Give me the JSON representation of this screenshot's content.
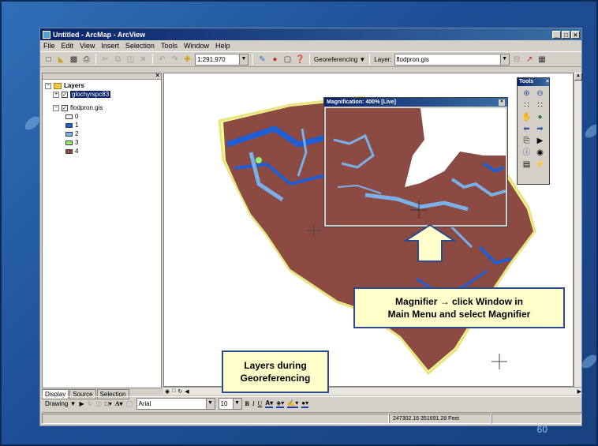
{
  "window": {
    "title": "Untitled - ArcMap - ArcView",
    "controls": [
      "_",
      "□",
      "×"
    ]
  },
  "menu": [
    "File",
    "Edit",
    "View",
    "Insert",
    "Selection",
    "Tools",
    "Window",
    "Help"
  ],
  "toolbar": {
    "scale": "1:291,970",
    "georeferencing_label": "Georeferencing ▼",
    "layer_label": "Layer:",
    "layer_value": "flodpron.gis"
  },
  "toc": {
    "root_label": "Layers",
    "layers": [
      {
        "name": "glochyrspc83",
        "selected": true
      },
      {
        "name": "flodpron.gis",
        "selected": false
      }
    ],
    "legend": [
      {
        "value": "0",
        "color": "#ffffff"
      },
      {
        "value": "1",
        "color": "#1f5fd6"
      },
      {
        "value": "2",
        "color": "#7ab0e8"
      },
      {
        "value": "3",
        "color": "#8ff07a"
      },
      {
        "value": "4",
        "color": "#8b4b43"
      }
    ],
    "tabs": [
      "Display",
      "Source",
      "Selection"
    ]
  },
  "tools_palette": {
    "title": "Tools"
  },
  "magnifier": {
    "title": "Magnification: 400% [Live]"
  },
  "callouts": {
    "magnifier_line1": "Magnifier → click Window in",
    "magnifier_line2": "Main Menu and select Magnifier",
    "layers_line1": "Layers during",
    "layers_line2": "Georeferencing"
  },
  "drawing_bar": {
    "drawing_label": "Drawing ▼",
    "font": "Arial",
    "size": "10"
  },
  "status": {
    "coords": "247302.16  351691.28 Feet"
  },
  "slide": {
    "number": "60"
  },
  "colors": {
    "land": "#8b4b43",
    "water_dark": "#1f5fd6",
    "water_light": "#7ab0e8",
    "accent": "#8ff07a"
  }
}
